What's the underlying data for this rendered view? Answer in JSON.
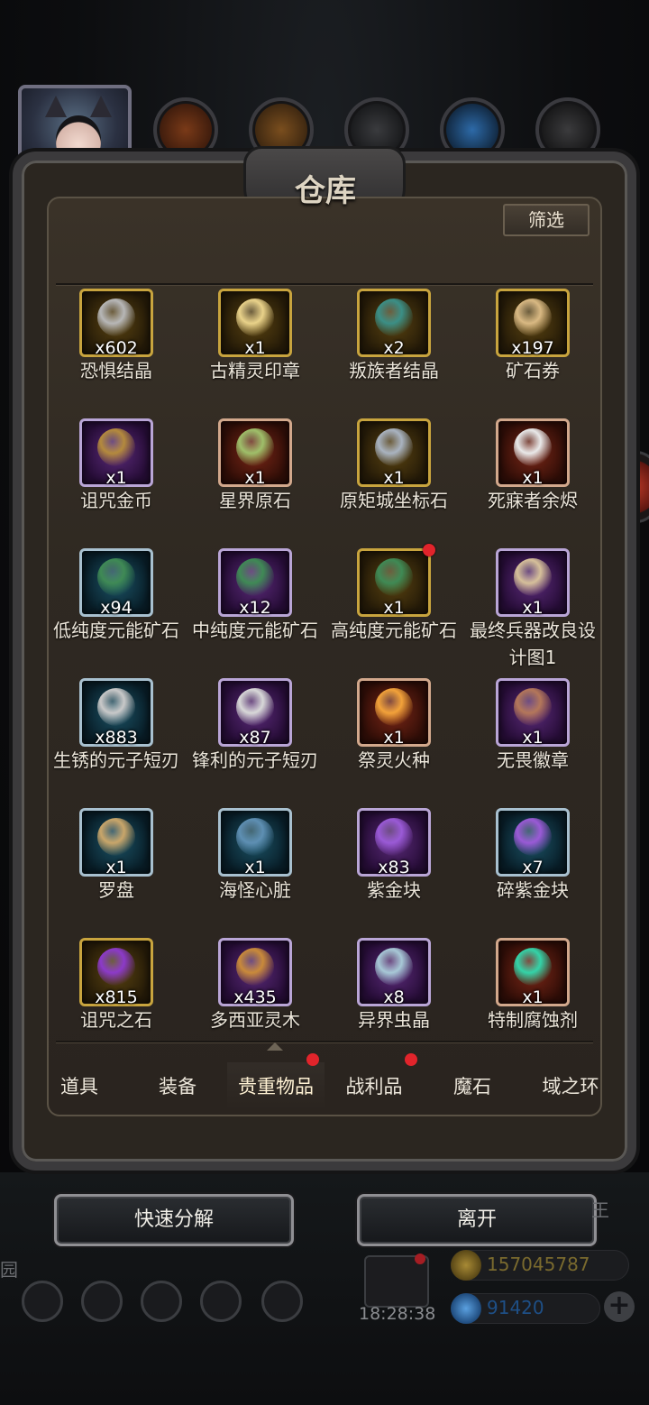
{
  "window": {
    "title": "仓库"
  },
  "toolbar": {
    "filter_label": "筛选"
  },
  "items": [
    {
      "name": "恐惧结晶",
      "count": "x602",
      "rarity": "gold",
      "icon": "grey-crystal-icon",
      "color": "#b7b7b7"
    },
    {
      "name": "古精灵印章",
      "count": "x1",
      "rarity": "gold",
      "icon": "golden-seal-icon",
      "color": "#e9d28a"
    },
    {
      "name": "叛族者结晶",
      "count": "x2",
      "rarity": "gold",
      "icon": "teal-crystal-icon",
      "color": "#3b8f86"
    },
    {
      "name": "矿石券",
      "count": "x197",
      "rarity": "gold",
      "icon": "scroll-icon",
      "color": "#d9b983"
    },
    {
      "name": "诅咒金币",
      "count": "x1",
      "rarity": "purple",
      "icon": "lion-coin-icon",
      "color": "#b48a3d"
    },
    {
      "name": "星界原石",
      "count": "x1",
      "rarity": "red",
      "icon": "green-ore-icon",
      "color": "#9fbf6a"
    },
    {
      "name": "原矩城坐标石",
      "count": "x1",
      "rarity": "gold",
      "icon": "stone-cube-icon",
      "color": "#a9b3c0"
    },
    {
      "name": "死寐者余烬",
      "count": "x1",
      "rarity": "red",
      "icon": "ash-pile-icon",
      "color": "#e9e9e9"
    },
    {
      "name": "低纯度元能矿石",
      "count": "x94",
      "rarity": "blue",
      "icon": "green-ore-cluster-icon",
      "color": "#3f8a55"
    },
    {
      "name": "中纯度元能矿石",
      "count": "x12",
      "rarity": "purple",
      "icon": "green-ore-cluster-icon",
      "color": "#3f8a55"
    },
    {
      "name": "高纯度元能矿石",
      "count": "x1",
      "rarity": "gold",
      "icon": "green-ore-cluster-icon",
      "color": "#3f8a55",
      "new": true
    },
    {
      "name": "最终兵器改良设计图1",
      "count": "x1",
      "rarity": "purple",
      "icon": "blueprint-icon",
      "color": "#d6c09a"
    },
    {
      "name": "生锈的元子短刃",
      "count": "x883",
      "rarity": "blue",
      "icon": "dagger-icon",
      "color": "#c9c9c9"
    },
    {
      "name": "锋利的元子短刃",
      "count": "x87",
      "rarity": "purple",
      "icon": "dagger-icon",
      "color": "#d8d8d8"
    },
    {
      "name": "祭灵火种",
      "count": "x1",
      "rarity": "red",
      "icon": "flame-icon",
      "color": "#f2a23a"
    },
    {
      "name": "无畏徽章",
      "count": "x1",
      "rarity": "purple",
      "icon": "shield-emblem-icon",
      "color": "#b4775a"
    },
    {
      "name": "罗盘",
      "count": "x1",
      "rarity": "blue",
      "icon": "compass-icon",
      "color": "#c9a66a"
    },
    {
      "name": "海怪心脏",
      "count": "x1",
      "rarity": "blue",
      "icon": "heart-icon",
      "color": "#5e8fb3"
    },
    {
      "name": "紫金块",
      "count": "x83",
      "rarity": "purple",
      "icon": "purple-crystal-icon",
      "color": "#9a5ad6"
    },
    {
      "name": "碎紫金块",
      "count": "x7",
      "rarity": "blue",
      "icon": "purple-shard-icon",
      "color": "#9a5ad6"
    },
    {
      "name": "诅咒之石",
      "count": "x815",
      "rarity": "gold",
      "icon": "purple-stone-icon",
      "color": "#8c3ac9"
    },
    {
      "name": "多西亚灵木",
      "count": "x435",
      "rarity": "purple",
      "icon": "wood-log-icon",
      "color": "#c98a3a"
    },
    {
      "name": "异界虫晶",
      "count": "x8",
      "rarity": "purple",
      "icon": "ice-shard-icon",
      "color": "#a7c8d6"
    },
    {
      "name": "特制腐蚀剂",
      "count": "x1",
      "rarity": "red",
      "icon": "potion-flask-icon",
      "color": "#34d3a8"
    }
  ],
  "tabs": [
    {
      "label": "道具",
      "dot": false
    },
    {
      "label": "装备",
      "dot": false
    },
    {
      "label": "贵重物品",
      "dot": true,
      "active": true
    },
    {
      "label": "战利品",
      "dot": true
    },
    {
      "label": "魔石",
      "dot": false
    },
    {
      "label": "域之环",
      "dot": false
    }
  ],
  "actions": {
    "decompose_label": "快速分解",
    "exit_label": "离开"
  },
  "hud": {
    "clock": "18:28:38",
    "gold": "157045787",
    "gems": "91420",
    "left_edge_text": "园",
    "right_edge_text": "王"
  },
  "colors": {
    "gold_res": "#7a6a2e",
    "gem_res": "#1e4f86",
    "new_dot": "#e1242b"
  }
}
